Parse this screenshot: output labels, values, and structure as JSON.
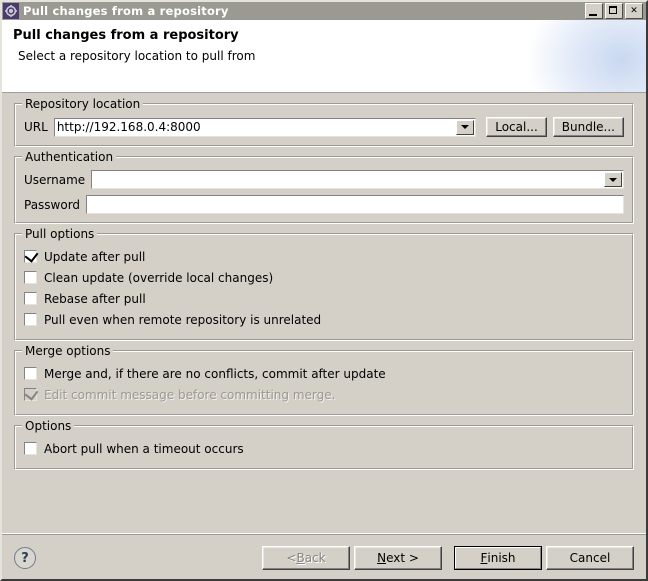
{
  "window": {
    "title": "Pull changes from a repository",
    "icon": "gear-icon",
    "minimize_label": "_",
    "maximize_label": "□",
    "close_label": "✕"
  },
  "header": {
    "title": "Pull changes from a repository",
    "subtitle": "Select a repository location to pull from"
  },
  "repository_location": {
    "legend": "Repository location",
    "url_label": "URL",
    "url_value": "http://192.168.0.4:8000",
    "url_placeholder": "",
    "local_button": "Local...",
    "bundle_button": "Bundle..."
  },
  "authentication": {
    "legend": "Authentication",
    "username_label": "Username",
    "username_value": "",
    "password_label": "Password",
    "password_value": ""
  },
  "pull_options": {
    "legend": "Pull options",
    "items": [
      {
        "label": "Update after pull",
        "checked": true,
        "enabled": true
      },
      {
        "label": "Clean update (override local changes)",
        "checked": false,
        "enabled": true
      },
      {
        "label": "Rebase after pull",
        "checked": false,
        "enabled": true
      },
      {
        "label": "Pull even when remote repository is unrelated",
        "checked": false,
        "enabled": true
      }
    ]
  },
  "merge_options": {
    "legend": "Merge options",
    "items": [
      {
        "label": "Merge and, if there are no conflicts, commit after update",
        "checked": false,
        "enabled": true
      },
      {
        "label": "Edit commit message before committing merge.",
        "checked": true,
        "enabled": false
      }
    ]
  },
  "options": {
    "legend": "Options",
    "items": [
      {
        "label": "Abort pull when a timeout occurs",
        "checked": false,
        "enabled": true
      }
    ]
  },
  "footer": {
    "help_label": "?",
    "back_label": "< Back",
    "back_prefix": "< ",
    "back_mnemonic": "B",
    "back_rest": "ack",
    "next_prefix": "",
    "next_mnemonic": "N",
    "next_rest": "ext >",
    "finish_mnemonic": "F",
    "finish_rest": "inish",
    "cancel_label": "Cancel"
  },
  "colors": {
    "dialog_bg": "#d4d0c8",
    "titlebar_bg": "#9a9a92",
    "header_bg": "#ffffff",
    "header_accent": "#c9d8f0",
    "field_bg": "#ffffff",
    "disabled_text": "#9b9893"
  }
}
